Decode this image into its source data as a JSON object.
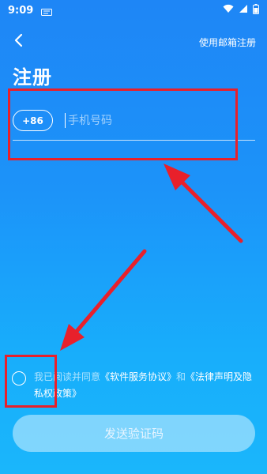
{
  "status_bar": {
    "time": "9:09"
  },
  "header": {
    "email_register_link": "使用邮箱注册"
  },
  "page_title": "注册",
  "phone": {
    "country_code": "+86",
    "placeholder": "手机号码",
    "value": ""
  },
  "agreement": {
    "prefix": "我已阅读并同意",
    "software_service_agreement": "《软件服务协议》",
    "conjunction": "和",
    "legal_statement_privacy": "《法律声明及隐私权政策》"
  },
  "send_code_button": "发送验证码",
  "colors": {
    "background_top": "#1e86f6",
    "background_bottom": "#1ab6fb",
    "annotation_red": "#e8202b"
  },
  "icons": {
    "back": "chevron-left-icon",
    "wifi": "wifi-icon",
    "signal": "cell-signal-icon",
    "battery": "battery-icon",
    "sim": "sim-notification-icon"
  }
}
